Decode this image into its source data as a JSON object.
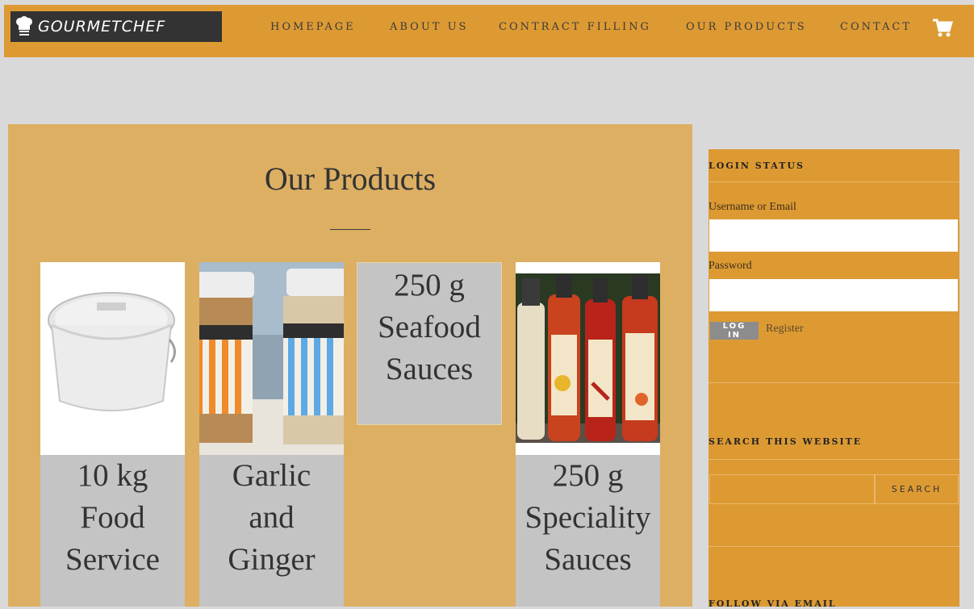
{
  "brand": {
    "name": "GOURMETCHEF"
  },
  "nav": {
    "items": [
      "HOMEPAGE",
      "ABOUT US",
      "CONTRACT FILLING",
      "OUR PRODUCTS",
      "CONTACT"
    ],
    "cart_icon": "shopping-cart-icon"
  },
  "main": {
    "title": "Our Products",
    "products": [
      {
        "label": "10 kg Food Service",
        "label_lines": [
          "10 kg",
          "Food",
          "Service"
        ],
        "has_image": true
      },
      {
        "label": "Garlic and Ginger",
        "label_lines": [
          "Garlic",
          "and",
          "Ginger"
        ],
        "has_image": true
      },
      {
        "label": "250 g Seafood Sauces",
        "label_lines": [
          "250 g",
          "Seafood",
          "Sauces"
        ],
        "has_image": false
      },
      {
        "label": "250 g Speciality Sauces",
        "label_lines": [
          "250 g",
          "Speciality",
          "Sauces"
        ],
        "has_image": true
      }
    ]
  },
  "sidebar": {
    "login": {
      "title": "LOGIN STATUS",
      "username_label": "Username or Email",
      "password_label": "Password",
      "login_button": "LOG IN",
      "register_link": "Register"
    },
    "search": {
      "title": "SEARCH THIS WEBSITE",
      "button": "SEARCH"
    },
    "follow": {
      "title": "FOLLOW VIA EMAIL"
    }
  },
  "colors": {
    "header_bg": "#dd9a33",
    "page_bg": "#d9d9d9",
    "content_bg": "#dcaf63",
    "label_bg": "#c4c4c4"
  }
}
